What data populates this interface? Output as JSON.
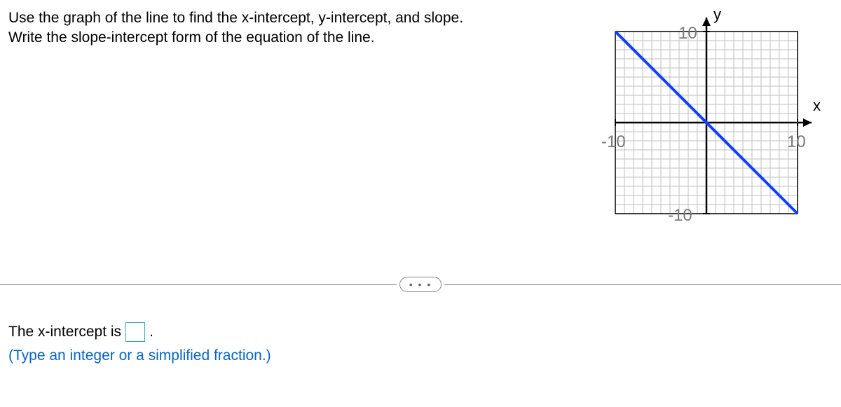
{
  "prompt": {
    "line1": "Use the graph of the line to find the x-intercept, y-intercept, and slope.",
    "line2": "Write the slope-intercept form of the equation of the line."
  },
  "graph": {
    "x_label": "x",
    "y_label": "y",
    "tick_neg_x": "-10",
    "tick_pos_x": "10",
    "tick_neg_y": "-10",
    "tick_pos_y": "10"
  },
  "divider": {
    "dots": "• • •"
  },
  "answer": {
    "prefix": "The x-intercept is",
    "suffix": ".",
    "hint": "(Type an integer or a simplified fraction.)"
  },
  "chart_data": {
    "type": "line",
    "title": "",
    "xlabel": "x",
    "ylabel": "y",
    "xlim": [
      -10,
      10
    ],
    "ylim": [
      -10,
      10
    ],
    "grid": true,
    "series": [
      {
        "name": "line",
        "x": [
          -10,
          10
        ],
        "y": [
          10,
          -10
        ],
        "color": "#1040ff"
      }
    ]
  }
}
